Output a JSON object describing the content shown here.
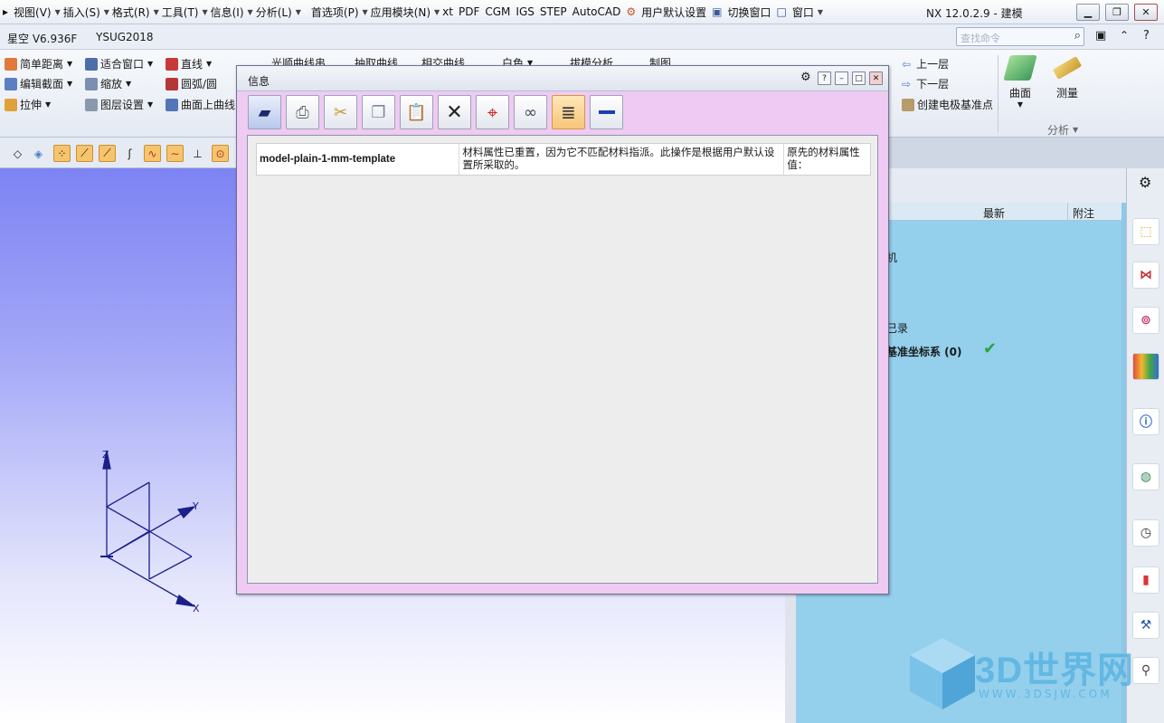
{
  "menubar": {
    "items": [
      "视图(V)",
      "插入(S)",
      "格式(R)",
      "工具(T)",
      "信息(I)",
      "分析(L)",
      "首选项(P)",
      "应用模块(N)"
    ],
    "extras": [
      "xt",
      "PDF",
      "CGM",
      "IGS",
      "STEP",
      "AutoCAD"
    ],
    "user_defaults": "用户默认设置",
    "switch_window": "切换窗口",
    "window": "窗口",
    "app_title": "NX 12.0.2.9 - 建模"
  },
  "row2": {
    "plugin1": "星空 V6.936F",
    "plugin2": "YSUG2018",
    "search_placeholder": "查找命令"
  },
  "ribbon": {
    "left": [
      [
        "简单距离",
        "编辑截面",
        "拉伸"
      ],
      [
        "适合窗口",
        "缩放",
        "图层设置"
      ],
      [
        "直线",
        "圆弧/圆",
        "曲面上曲线"
      ]
    ],
    "hidden_row": [
      "光顺曲线串",
      "抽取曲线",
      "相交曲线",
      "白色",
      "拔模分析",
      "制图"
    ],
    "layer_up": "上一层",
    "layer_down": "下一层",
    "create_datum": "创建电极基准点",
    "surface": "曲面",
    "measure": "测量",
    "analysis_group": "分析"
  },
  "dialog": {
    "title": "信息",
    "toolbar": [
      "save-as",
      "print",
      "cut",
      "copy",
      "paste",
      "clear",
      "pick",
      "find",
      "word-wrap",
      "collapse"
    ],
    "row": {
      "name": "model-plain-1-mm-template",
      "message": "材料属性已重置，因为它不匹配材料指派。此操作是根据用户默认设置所采取的。",
      "original": "原先的材料属性值："
    }
  },
  "navigator": {
    "col_latest": "最新",
    "col_note": "附注",
    "item_partial1": "机",
    "item_partial2": "已录",
    "item_datum": "基准坐标系 (0)"
  },
  "axes": {
    "z": "Z",
    "y": "Y",
    "x": "X"
  },
  "watermark": {
    "brand": "3D世界网",
    "url": "WWW.3DSJW.COM"
  }
}
